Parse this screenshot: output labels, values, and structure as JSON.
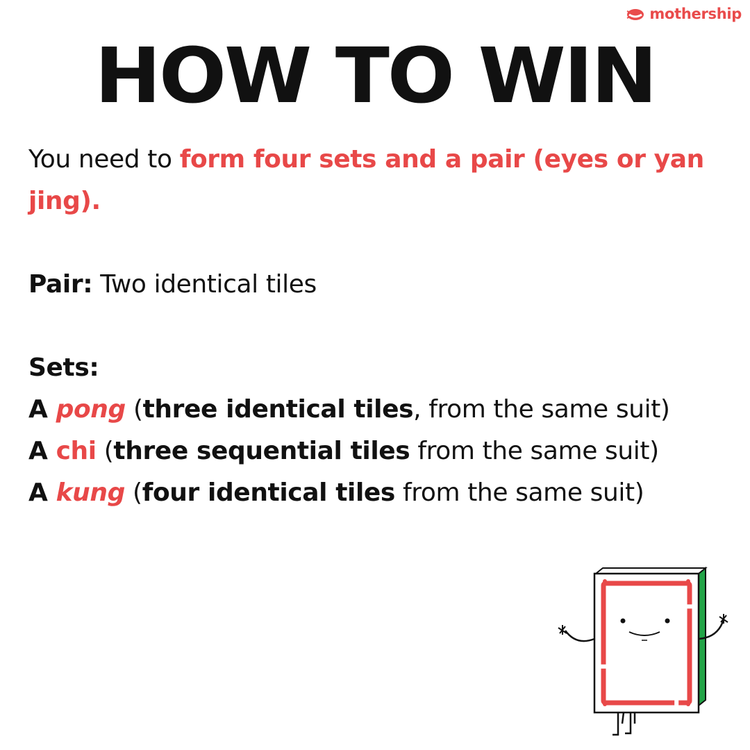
{
  "brand": {
    "name": "mothership",
    "color": "#e94b4b",
    "icon": "mothership-logo-icon"
  },
  "title": "HOW TO WIN",
  "intro": {
    "lead": "You need to ",
    "highlight": "form four sets and a pair (eyes or yan jing)."
  },
  "pair": {
    "label": "Pair:",
    "text": " Two identical tiles"
  },
  "sets": {
    "label": "Sets:",
    "items": [
      {
        "prefix": "A ",
        "term": "pong",
        "open": " (",
        "bold": "three identical tiles",
        "rest": ", from the same suit)"
      },
      {
        "prefix": "A ",
        "term": "chi",
        "open": " (",
        "bold": "three sequential tiles",
        "rest": " from the same suit)"
      },
      {
        "prefix": "A ",
        "term": "kung",
        "open": " (",
        "bold": "four identical tiles",
        "rest": " from the same suit)"
      }
    ]
  },
  "colors": {
    "accent": "#e84848",
    "text": "#111111",
    "tile_side": "#22a447"
  },
  "illustration": {
    "icon": "mahjong-tile-mascot-icon"
  }
}
